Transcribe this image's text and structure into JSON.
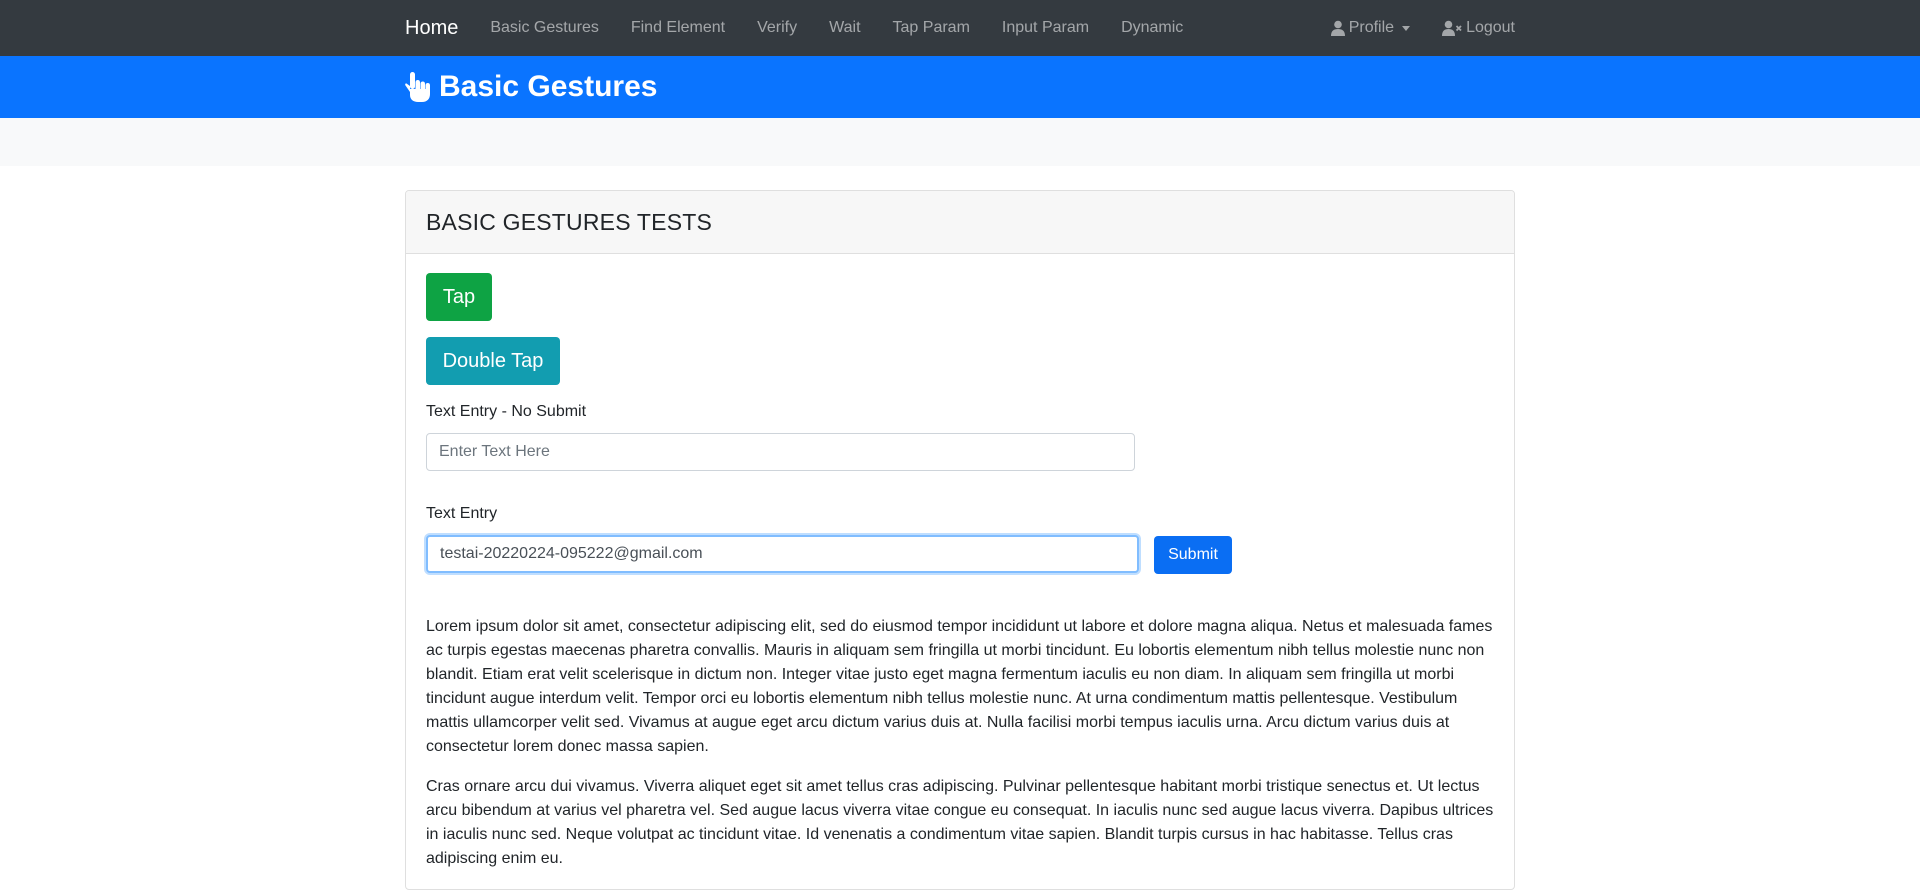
{
  "navbar": {
    "brand": "Home",
    "links": [
      "Basic Gestures",
      "Find Element",
      "Verify",
      "Wait",
      "Tap Param",
      "Input Param",
      "Dynamic"
    ],
    "profile_label": "Profile",
    "logout_label": "Logout"
  },
  "banner": {
    "title": "Basic Gestures"
  },
  "card": {
    "title": "BASIC GESTURES TESTS",
    "tap_label": "Tap",
    "double_tap_label": "Double Tap",
    "text_entry_no_submit_label": "Text Entry - No Submit",
    "text_entry_no_submit_placeholder": "Enter Text Here",
    "text_entry_label": "Text Entry",
    "text_entry_value": "testai-20220224-095222@gmail.com",
    "submit_label": "Submit",
    "paragraph_1": "Lorem ipsum dolor sit amet, consectetur adipiscing elit, sed do eiusmod tempor incididunt ut labore et dolore magna aliqua. Netus et malesuada fames ac turpis egestas maecenas pharetra convallis. Mauris in aliquam sem fringilla ut morbi tincidunt. Eu lobortis elementum nibh tellus molestie nunc non blandit. Etiam erat velit scelerisque in dictum non. Integer vitae justo eget magna fermentum iaculis eu non diam. In aliquam sem fringilla ut morbi tincidunt augue interdum velit. Tempor orci eu lobortis elementum nibh tellus molestie nunc. At urna condimentum mattis pellentesque. Vestibulum mattis ullamcorper velit sed. Vivamus at augue eget arcu dictum varius duis at. Nulla facilisi morbi tempus iaculis urna. Arcu dictum varius duis at consectetur lorem donec massa sapien.",
    "paragraph_2": "Cras ornare arcu dui vivamus. Viverra aliquet eget sit amet tellus cras adipiscing. Pulvinar pellentesque habitant morbi tristique senectus et. Ut lectus arcu bibendum at varius vel pharetra vel. Sed augue lacus viverra vitae congue eu consequat. In iaculis nunc sed augue lacus viverra. Dapibus ultrices in iaculis nunc sed. Neque volutpat ac tincidunt vitae. Id venenatis a condimentum vitae sapien. Blandit turpis cursus in hac habitasse. Tellus cras adipiscing enim eu."
  },
  "icons": {
    "banner": "pointing-hand-icon",
    "profile": "user-icon",
    "logout": "user-remove-icon"
  },
  "colors": {
    "navbar_bg": "#343a40",
    "banner_bg": "#0a74ff",
    "tap_button": "#0ea344",
    "double_tap_button": "#129db0",
    "submit_button": "#0a6ef3"
  }
}
